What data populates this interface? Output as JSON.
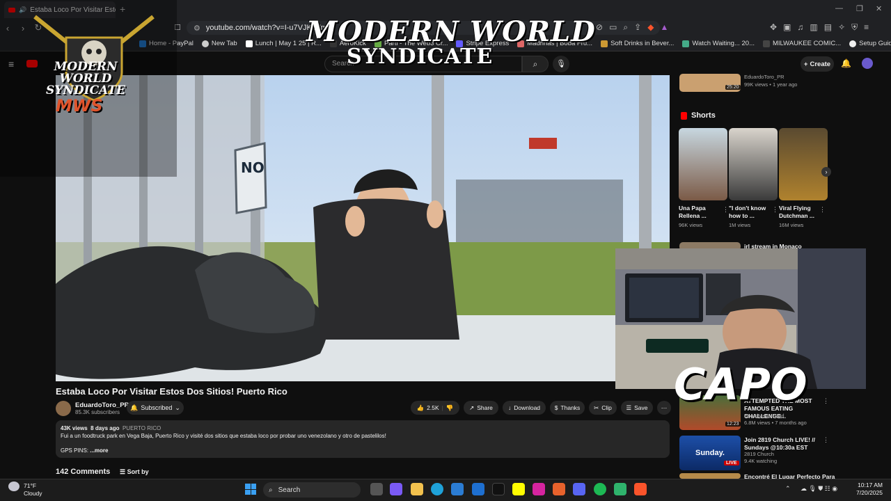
{
  "browser": {
    "tab_title": "Estaba Loco Por Visitar Estos",
    "url": "youtube.com/watch?v=I-u7VJKJVm0",
    "bookmarks": [
      "Home - PayPal",
      "New Tab",
      "Lunch | May 1 25 | R...",
      "AeroKick",
      "Parti - The Web3 Cr...",
      "Stripe Express",
      "Madrinas | Boba Fru...",
      "Soft Drinks in Bever...",
      "Watch Waiting... 20...",
      "MILWAUKEE COMIC...",
      "Setup Guide - moon..."
    ]
  },
  "youtube": {
    "search_placeholder": "Search",
    "create_label": "Create",
    "video": {
      "title": "Estaba Loco Por Visitar Estos Dos Sitios! Puerto Rico",
      "channel": "EduardoToro_PR",
      "subscribers": "85.3K subscribers",
      "subscribed_label": "Subscribed",
      "likes": "2.5K",
      "actions": [
        "Share",
        "Download",
        "Thanks",
        "Clip",
        "Save"
      ],
      "views": "43K views",
      "age": "8 days ago",
      "location": "PUERTO RICO",
      "description": "Fui a un foodtruck park en Vega Baja, Puerto Rico y visité dos sitios que estaba loco por probar uno venezolano y otro de pastelilos!",
      "description_more_prefix": "GPS PINS:",
      "more_label": "...more",
      "sign_text": "NO"
    },
    "comments_count": "142 Comments",
    "sort_label": "Sort by",
    "sidebar": {
      "top_item": {
        "channel": "EduardoToro_PR",
        "meta": "99K views • 1 year ago",
        "duration": "25:20"
      },
      "shorts_label": "Shorts",
      "shorts": [
        {
          "title": "Una Papa Rellena ...",
          "views": "96K views"
        },
        {
          "title": "\"I don't know how to ...",
          "views": "1M views"
        },
        {
          "title": "Viral Flying Dutchman ...",
          "views": "16M views"
        }
      ],
      "irl_title": "irl stream in Monaco",
      "items": [
        {
          "title": "ATTEMPTED THE MOST FAMOUS EATING CHALLENGE...",
          "channel": "BeardMeatsFood",
          "meta": "6.8M views • 7 months ago",
          "duration": "12:23"
        },
        {
          "title": "Join 2819 Church LIVE! // Sundays @10:30a EST",
          "channel": "2819 Church",
          "meta": "9.4K watching",
          "badge": "LIVE",
          "thumb_text": "Sunday."
        },
        {
          "title": "Encontré El Lugar Perfecto Para"
        }
      ]
    }
  },
  "overlays": {
    "logo_line1": "MODERN WORLD",
    "logo_line2": "SYNDICATE",
    "logo_abbr": "MWS",
    "banner_line1": "MODERN WORLD",
    "banner_line2": "SYNDICATE",
    "webcam_name": "CAPO"
  },
  "taskbar": {
    "weather_temp": "71°F",
    "weather_desc": "Cloudy",
    "search_label": "Search",
    "time": "10:17 AM",
    "date": "7/20/2025"
  }
}
